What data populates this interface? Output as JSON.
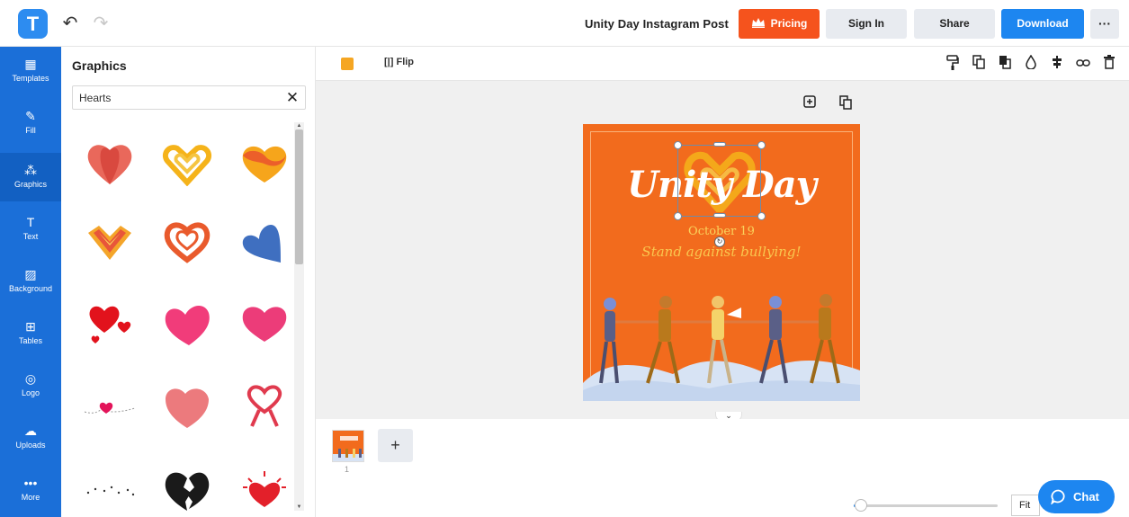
{
  "app": {
    "logo_letter": "T"
  },
  "topbar": {
    "doc_title": "Unity Day Instagram Post",
    "pricing_label": "Pricing",
    "signin_label": "Sign In",
    "share_label": "Share",
    "download_label": "Download",
    "more_label": "···",
    "undo_icon": "↶",
    "redo_icon": "↷"
  },
  "rail": {
    "items": [
      {
        "label": "Templates",
        "icon": "▦"
      },
      {
        "label": "Fill",
        "icon": "✎"
      },
      {
        "label": "Graphics",
        "icon": "⁂"
      },
      {
        "label": "Text",
        "icon": "T"
      },
      {
        "label": "Background",
        "icon": "▨"
      },
      {
        "label": "Tables",
        "icon": "⊞"
      },
      {
        "label": "Logo",
        "icon": "◎"
      },
      {
        "label": "Uploads",
        "icon": "☁"
      },
      {
        "label": "More",
        "icon": "•••"
      }
    ]
  },
  "panel": {
    "title": "Graphics",
    "search_value": "Hearts",
    "clear_icon": "✕"
  },
  "toolbar": {
    "flip_label": "Flip",
    "flip_icon": "[|]",
    "swatch_color": "#f5a623"
  },
  "poster": {
    "title": "Unity Day",
    "date": "October 19",
    "tagline": "Stand against bullying!",
    "background": "#f26b1d"
  },
  "pages": {
    "thumb_number": "1",
    "add_label": "+"
  },
  "zoom": {
    "level": 0.05,
    "fit_label": "Fit"
  },
  "chat": {
    "label": "Chat"
  },
  "colors": {
    "brand": "#1d86f0",
    "pricing": "#f5531d",
    "rail": "#1b6fd8"
  }
}
